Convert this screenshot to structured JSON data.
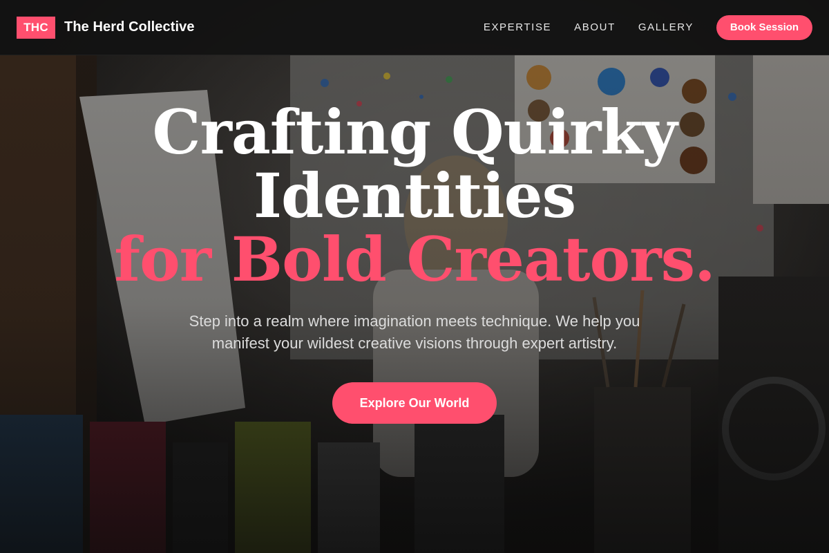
{
  "header": {
    "logo_badge": "THC",
    "brand_name": "The Herd Collective",
    "nav": [
      {
        "label": "EXPERTISE"
      },
      {
        "label": "ABOUT"
      },
      {
        "label": "GALLERY"
      }
    ],
    "cta_label": "Book Session"
  },
  "hero": {
    "title_line1": "Crafting Quirky",
    "title_line2": "Identities",
    "title_line3": "for Bold Creators.",
    "subtitle": "Step into a realm where imagination meets technique. We help you manifest your wildest creative visions through expert artistry.",
    "cta_label": "Explore Our World"
  },
  "colors": {
    "accent": "#ff4f6e",
    "header_bg": "#121212",
    "text_primary": "#ffffff",
    "text_secondary": "#dcdcdc"
  }
}
